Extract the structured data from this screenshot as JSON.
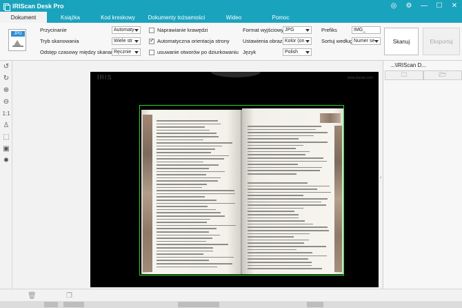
{
  "title_bar": {
    "title": "IRIScan Desk Pro"
  },
  "tabs": [
    {
      "label": "Dokument",
      "active": true
    },
    {
      "label": "Książka"
    },
    {
      "label": "Kod kreskowy"
    },
    {
      "label": "Dokumenty tożsamości"
    },
    {
      "label": "Wideo"
    },
    {
      "label": "Pomoc"
    }
  ],
  "ribbon": {
    "icon_label": "JPG",
    "crop_label": "Przycinanie",
    "crop_value": "Automaty",
    "scan_mode_label": "Tryb skanowania",
    "scan_mode_value": "Wiele str",
    "interval_label": "Odstęp czasowy między skanami",
    "interval_value": "Ręcznie",
    "fix_edges_label": "Naprawianie krawędzi",
    "auto_orient_label": "Automatyczna orientacja strony",
    "remove_holes_label": "usuwanie otworów po dziurkowaniu",
    "output_format_label": "Format wyjściowy",
    "output_format_value": "JPG",
    "image_settings_label": "Ustawienia obrazu",
    "image_settings_value": "Kolor (on",
    "language_label": "Język",
    "language_value": "Polish",
    "prefix_label": "Prefiks",
    "prefix_value": "IMG_",
    "sort_label": "Sortuj według",
    "sort_value": "Numer se",
    "scan_button": "Skanuj",
    "export_button": "Eksportuj"
  },
  "preview": {
    "brand": "IRIS",
    "watermark": "www.iriscan.com"
  },
  "right_panel": {
    "title": "...\\IRIScan D..."
  },
  "colors": {
    "accent": "#1aa3bd",
    "frame": "#22dd22"
  }
}
